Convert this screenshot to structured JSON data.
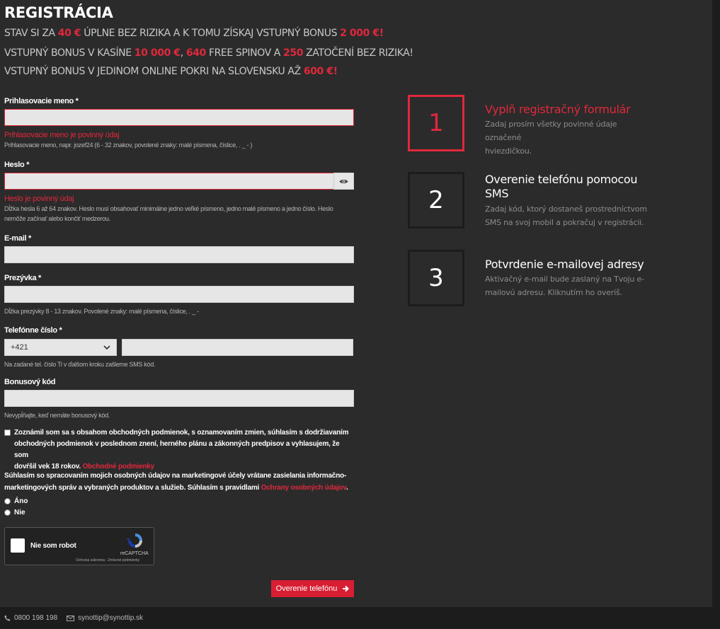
{
  "header": {
    "title": "REGISTRÁCIA",
    "promo1": {
      "a": "STAV SI ZA ",
      "b": "40 €",
      "c": " ÚPLNE BEZ RIZIKA A K TOMU ZÍSKAJ VSTUPNÝ BONUS ",
      "d": "2 000 €!"
    },
    "promo2": {
      "a": "VSTUPNÝ BONUS V KASÍNE ",
      "b": "10 000 €",
      "c": ", ",
      "d": "640",
      "e": " FREE SPINOV A ",
      "f": "250",
      "g": " ZATOČENÍ BEZ RIZIKA!"
    },
    "promo3": {
      "a": "VSTUPNÝ BONUS V JEDINOM ONLINE POKRI NA SLOVENSKU AŽ ",
      "b": "600 €!"
    }
  },
  "form": {
    "username": {
      "label": "Prihlasovacie meno *",
      "value": "",
      "error": "Prihlasovacie meno je povinný údaj",
      "hint": "Prihlasovacie meno, napr. jozef24 (6 - 32 znakov, povolené znaky: malé písmena, číslice, . _ - )"
    },
    "password": {
      "label": "Heslo *",
      "value": "",
      "error": "Heslo je povinný údaj",
      "hint1": "Dĺžka hesla 6 až 64 znakov. Heslo musí obsahovať minimálne jedno veľké písmeno, jedno malé písmeno a jedno číslo. Heslo",
      "hint2": "nemôže začínať alebo končiť medzerou."
    },
    "email": {
      "label": "E-mail *",
      "value": ""
    },
    "surname": {
      "label": "Prezývka *",
      "value": "",
      "hint": "Dĺžka prezývky 8 - 13 znakov. Povolené znaky: malé písmena, číslice, . _ -"
    },
    "phone": {
      "label": "Telefónne číslo *",
      "prefix": "+421",
      "value": "",
      "hint": "Na zadané tel. číslo Ti v ďalšom kroku zašleme SMS kód."
    },
    "bonus": {
      "label": "Bonusový kód",
      "value": "",
      "hint": "Nevypĺňajte, keď nemáte bonusový kód."
    },
    "terms": {
      "text1": "Zoznámil som sa s obsahom obchodných podmienok, s oznamovaním zmien, súhlasím s dodržiavaním",
      "text2": "obchodných podmienok v poslednom znení, herného plánu a zákonných predpisov a vyhlasujem, že som",
      "text3": "dovŕšil vek 18 rokov. ",
      "link": "Obchodné podmienky"
    },
    "consent": {
      "text1": "Súhlasím so spracovaním mojich osobných údajov na marketingové účely vrátane zasielania informačno-",
      "text2": "marketingových správ a vybraných produktov a služieb. Súhlasím s pravidlami ",
      "link": "Ochrany osobných údajov",
      "end": ".",
      "yes": "Áno",
      "no": "Nie"
    },
    "captcha": {
      "label": "Nie som robot",
      "brand": "reCAPTCHA",
      "terms": "Ochrana súkromia - Zmluvné podmienky"
    },
    "submit": "Overenie telefónu"
  },
  "steps": [
    {
      "number": "1",
      "title": "Vyplň registračný formulár",
      "desc1": "Zadaj prosím všetky povinné údaje označené",
      "desc2": "hviezdičkou.",
      "active": true
    },
    {
      "number": "2",
      "title1": "Overenie telefónu pomocou",
      "title2": "SMS",
      "desc1": "Zadaj kód, ktorý dostaneš prostredníctvom",
      "desc2": "SMS na svoj mobil a pokračuj v registrácii.",
      "active": false
    },
    {
      "number": "3",
      "title": "Potvrdenie e-mailovej adresy",
      "desc1": "Aktivačný e-mail bude zaslaný na Tvoju e-",
      "desc2": "mailovú adresu. Kliknutím ho overíš.",
      "active": false
    }
  ],
  "footer": {
    "phone": "0800 198 198",
    "email": "synottip@synottip.sk"
  },
  "colors": {
    "accent": "#e0283c",
    "background": "#2b2b2b",
    "footer": "#1c1c1c"
  }
}
